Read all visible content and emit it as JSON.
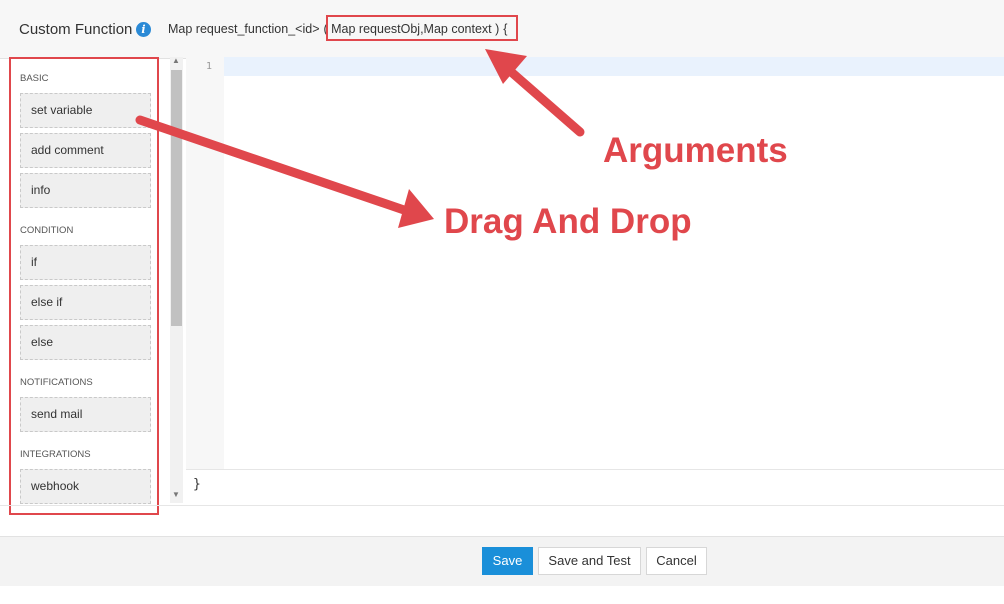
{
  "header": {
    "title": "Custom Function",
    "info_icon": "i",
    "signature_prefix": "Map request_function_<id>",
    "signature_args": "( Map requestObj,Map context )",
    "signature_suffix": "{"
  },
  "sidebar": {
    "sections": [
      {
        "title": "BASIC",
        "items": [
          "set variable",
          "add comment",
          "info"
        ]
      },
      {
        "title": "CONDITION",
        "items": [
          "if",
          "else if",
          "else"
        ]
      },
      {
        "title": "NOTIFICATIONS",
        "items": [
          "send mail"
        ]
      },
      {
        "title": "INTEGRATIONS",
        "items": [
          "webhook"
        ]
      }
    ]
  },
  "editor": {
    "line_numbers": [
      "1"
    ],
    "closing_brace": "}"
  },
  "footer": {
    "save_label": "Save",
    "save_test_label": "Save and Test",
    "cancel_label": "Cancel"
  },
  "annotations": {
    "arguments_label": "Arguments",
    "drag_drop_label": "Drag And Drop"
  },
  "colors": {
    "accent": "#1a8fd9",
    "annotation": "#e0474c"
  }
}
